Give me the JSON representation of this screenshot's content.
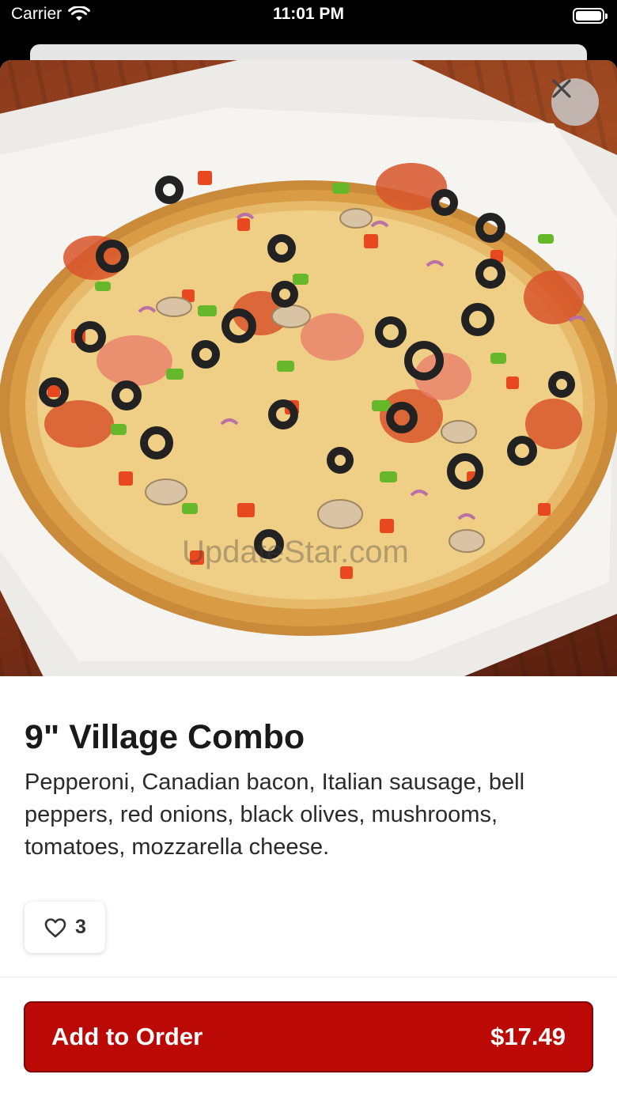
{
  "status_bar": {
    "carrier": "Carrier",
    "time": "11:01 PM"
  },
  "item": {
    "title": "9\" Village Combo",
    "description": "Pepperoni, Canadian bacon, Italian sausage, bell peppers, red onions, black olives, mushrooms, tomatoes, mozzarella cheese.",
    "image_alt": "pizza-photo"
  },
  "like": {
    "count": "3",
    "icon": "heart-outline-icon"
  },
  "order_button": {
    "label": "Add to Order",
    "price": "$17.49"
  },
  "colors": {
    "accent": "#bb0a06",
    "accent_border": "#7e0604",
    "text": "#1a1a1a"
  }
}
